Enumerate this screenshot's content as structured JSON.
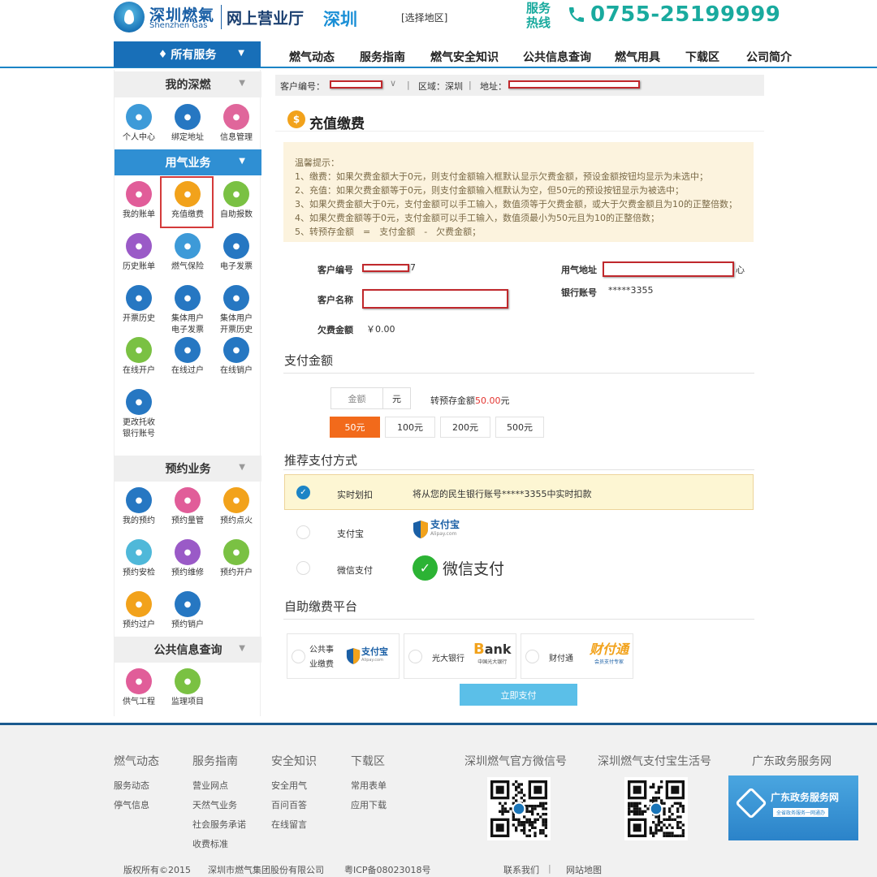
{
  "header": {
    "logo_cn": "深圳燃氣",
    "logo_en": "Shenzhen Gas",
    "site_title": "网上营业厅",
    "city": "深圳",
    "select_region": "[选择地区]",
    "hotline_label": "服务热线",
    "hotline_number": "0755-25199999"
  },
  "nav": {
    "all_services": "所有服务",
    "items": [
      "燃气动态",
      "服务指南",
      "燃气安全知识",
      "公共信息查询",
      "燃气用具",
      "下载区",
      "公司简介"
    ]
  },
  "sidebar": {
    "sections": [
      "我的深燃",
      "用气业务",
      "预约业务",
      "公共信息查询"
    ],
    "my_shenran": [
      {
        "label": "个人中心",
        "icon": "user-icon",
        "color": "#3d9ad8"
      },
      {
        "label": "绑定地址",
        "icon": "download-icon",
        "color": "#2677c2"
      },
      {
        "label": "信息管理",
        "icon": "users-icon",
        "color": "#e0669b"
      }
    ],
    "gas_business": [
      {
        "label": "我的账单",
        "icon": "bill-icon",
        "color": "#e15d99"
      },
      {
        "label": "充值缴费",
        "icon": "payment-icon",
        "color": "#f2a21b"
      },
      {
        "label": "自助报数",
        "icon": "meter-icon",
        "color": "#7ac143"
      },
      {
        "label": "历史账单",
        "icon": "yuan-icon",
        "color": "#9a5ac7"
      },
      {
        "label": "燃气保险",
        "icon": "shield-icon",
        "color": "#3d9ad8"
      },
      {
        "label": "电子发票",
        "icon": "printer-icon",
        "color": "#2677c2"
      },
      {
        "label": "开票历史",
        "icon": "clock-icon",
        "color": "#2677c2"
      },
      {
        "label": "集体用户\n电子发票",
        "icon": "printer-icon",
        "color": "#2677c2"
      },
      {
        "label": "集体用户\n开票历史",
        "icon": "clock-icon",
        "color": "#2677c2"
      },
      {
        "label": "在线开户",
        "icon": "edit-icon",
        "color": "#7ac143"
      },
      {
        "label": "在线过户",
        "icon": "document-icon",
        "color": "#2677c2"
      },
      {
        "label": "在线销户",
        "icon": "cancel-icon",
        "color": "#2677c2"
      },
      {
        "label": "更改托收\n银行账号",
        "icon": "document-icon",
        "color": "#2677c2"
      }
    ],
    "appointment": [
      {
        "label": "我的预约",
        "icon": "pen-icon",
        "color": "#2677c2"
      },
      {
        "label": "预约量管",
        "icon": "pipe-icon",
        "color": "#e15d99"
      },
      {
        "label": "预约点火",
        "icon": "fire-icon",
        "color": "#f2a21b"
      },
      {
        "label": "预约安检",
        "icon": "search-icon",
        "color": "#4fb8d9"
      },
      {
        "label": "预约维修",
        "icon": "tools-icon",
        "color": "#9a5ac7"
      },
      {
        "label": "预约开户",
        "icon": "document-icon",
        "color": "#7ac143"
      },
      {
        "label": "预约过户",
        "icon": "transfer-icon",
        "color": "#f2a21b"
      },
      {
        "label": "预约销户",
        "icon": "user-cancel-icon",
        "color": "#2677c2"
      }
    ],
    "public_info": [
      {
        "label": "供气工程",
        "icon": "search-icon",
        "color": "#e15d99"
      },
      {
        "label": "监理项目",
        "icon": "search-icon",
        "color": "#7ac143"
      }
    ]
  },
  "account_bar": {
    "customer_no_label": "客户编号：",
    "region": "区域：深圳",
    "address_label": "地址："
  },
  "page": {
    "title": "充值缴费",
    "notice": [
      "温馨提示：",
      "1、缴费：如果欠费金额大于0元，则支付金额输入框默认显示欠费金额，预设金额按钮均显示为未选中；",
      "2、充值：如果欠费金额等于0元，则支付金额输入框默认为空，但50元的预设按钮显示为被选中；",
      "3、如果欠费金额大于0元，支付金额可以手工输入，数值须等于欠费金额，或大于欠费金额且为10的正整倍数；",
      "4、如果欠费金额等于0元，支付金额可以手工输入，数值须最小为50元且为10的正整倍数；",
      "5、转预存金额　=　支付金额　-　欠费金额；"
    ],
    "customer_no_label": "客户编号",
    "customer_no_tail": "7",
    "customer_name_label": "客户名称",
    "arrears_label": "欠费金额",
    "arrears_value": "￥0.00",
    "gas_address_label": "用气地址",
    "gas_address_tail": "心",
    "bank_account_label": "银行账号",
    "bank_account_value": "*****3355"
  },
  "payment": {
    "section_title": "支付金额",
    "amount_placeholder": "金额",
    "unit": "元",
    "prestore_prefix": "转预存金额",
    "prestore_amount": "50.00",
    "prestore_suffix": "元",
    "presets": [
      "50元",
      "100元",
      "200元",
      "500元"
    ],
    "selected_preset": 0
  },
  "methods": {
    "section_title": "推荐支付方式",
    "realtime_label": "实时划扣",
    "realtime_desc": "将从您的民生银行账号*****3355中实时扣款",
    "alipay_label": "支付宝",
    "alipay_logo": "支付宝",
    "alipay_logo_sub": "Alipay.com",
    "wechat_label": "微信支付",
    "wechat_logo": "微信支付"
  },
  "platforms": {
    "section_title": "自助缴费平台",
    "public_label": "公共事业缴费",
    "public_label_1": "公共事",
    "public_label_2": "业缴费",
    "alipay_logo": "支付宝",
    "alipay_logo_sub": "Alipay.com",
    "ceb_label": "光大银行",
    "ceb_logo": "Bank",
    "ceb_logo_sub": "中国光大银行",
    "cft_label": "财付通",
    "cft_logo": "财付通",
    "cft_logo_sub": "会员支付专家",
    "submit": "立即支付"
  },
  "footer": {
    "col1": {
      "title": "燃气动态",
      "links": [
        "服务动态",
        "停气信息"
      ]
    },
    "col2": {
      "title": "服务指南",
      "links": [
        "营业网点",
        "天然气业务",
        "社会服务承诺",
        "收费标准"
      ]
    },
    "col3": {
      "title": "安全知识",
      "links": [
        "安全用气",
        "百问百答",
        "在线留言"
      ]
    },
    "col4": {
      "title": "下载区",
      "links": [
        "常用表单",
        "应用下载"
      ]
    },
    "wechat_title": "深圳燃气官方微信号",
    "alipay_title": "深圳燃气支付宝生活号",
    "gov_title": "广东政务服务网",
    "gov_banner": "广东政务服务网",
    "gov_banner_sub": "全省政务服务一网通办",
    "copyright": "版权所有©2015",
    "company": "深圳市燃气集团股份有限公司",
    "icp": "粤ICP备08023018号",
    "contact": "联系我们",
    "sitemap": "网站地图"
  },
  "colors": {
    "brand_blue": "#186fb8",
    "accent_orange": "#f26a1b",
    "hotline_teal": "#19aa9e",
    "redact_red": "#c0282c"
  }
}
